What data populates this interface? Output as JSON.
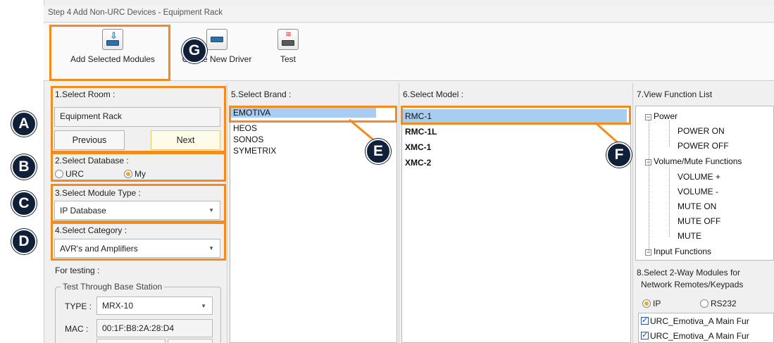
{
  "window": {
    "title": "Step 4 Add Non-URC Devices - Equipment Rack"
  },
  "toolbar": {
    "add_label": "Add Selected Modules",
    "create_label": "Create New Driver",
    "test_label": "Test"
  },
  "room": {
    "label": "1.Select Room :",
    "value": "Equipment Rack",
    "previous": "Previous",
    "next": "Next"
  },
  "database": {
    "label": "2.Select Database :",
    "options": [
      "URC",
      "My"
    ],
    "selected": "My"
  },
  "module_type": {
    "label": "3.Select Module Type :",
    "value": "IP Database"
  },
  "category": {
    "label": "4.Select Category :",
    "value": "AVR's and Amplifiers"
  },
  "testing": {
    "label": "For testing :",
    "group": "Test Through Base Station",
    "type_label": "TYPE :",
    "type_value": "MRX-10",
    "mac_label": "MAC :",
    "mac_value": "00:1F:B8:2A:28:D4"
  },
  "brand": {
    "label": "5.Select Brand :",
    "items": [
      "EMOTIVA",
      "HEOS",
      "SONOS",
      "SYMETRIX"
    ],
    "selected": "EMOTIVA"
  },
  "model": {
    "label": "6.Select Model :",
    "items": [
      "RMC-1",
      "RMC-1L",
      "XMC-1",
      "XMC-2"
    ],
    "selected": "RMC-1"
  },
  "functions": {
    "label": "7.View Function List",
    "power": "Power",
    "power_on": "POWER ON",
    "power_off": "POWER OFF",
    "volume": "Volume/Mute Functions",
    "vol_up": "VOLUME +",
    "vol_down": "VOLUME -",
    "mute_on": "MUTE ON",
    "mute_off": "MUTE OFF",
    "mute": "MUTE",
    "input": "Input Functions"
  },
  "twoway": {
    "label_line1": "8.Select 2-Way Modules for",
    "label_line2": "Network Remotes/Keypads",
    "ip": "IP",
    "rs232": "RS232",
    "selected": "IP",
    "items": [
      "URC_Emotiva_A Main Fur",
      "URC_Emotiva_A Main Fur"
    ]
  },
  "badges": {
    "a": "A",
    "b": "B",
    "c": "C",
    "d": "D",
    "e": "E",
    "f": "F",
    "g": "G"
  },
  "colors": {
    "highlight": "#f58a1f",
    "badge": "#0f2038",
    "selection": "#a8cdf2"
  }
}
